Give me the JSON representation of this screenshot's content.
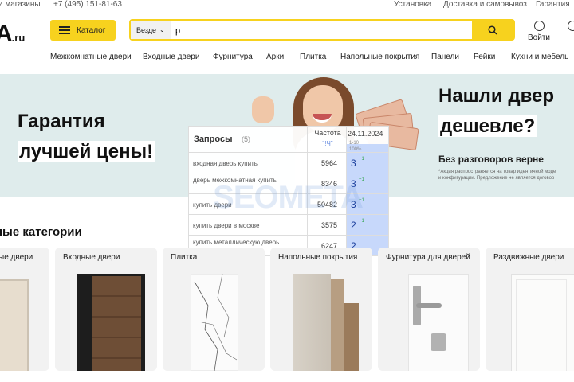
{
  "topbar": {
    "stores": "и магазины",
    "phone": "+7 (495) 151-81-63",
    "install": "Установка",
    "delivery": "Доставка и самовывоз",
    "warranty": "Гарантия"
  },
  "header": {
    "logo": "А",
    "logo_suffix": ".ru",
    "catalog": "Каталог",
    "search_scope": "Везде",
    "search_value": "р",
    "login": "Войти"
  },
  "nav": [
    "Межкомнатные двери",
    "Входные двери",
    "Фурнитура",
    "Арки",
    "Плитка",
    "Напольные покрытия",
    "Панели",
    "Рейки",
    "Кухни и мебель"
  ],
  "banner": {
    "left_line1": "Гарантия",
    "left_line2": "лучшей цены!",
    "right_line1": "Нашли двер",
    "right_line2": "дешевле?",
    "right_sub": "Без разговоров верне",
    "footnote_1": "*Акция распространяется на товар идентичной моде",
    "footnote_2": "и конфигурации. Предложение не является договор"
  },
  "overlay": {
    "title": "Запросы",
    "count": "(5)",
    "freq_label": "Частота",
    "freq_sub": "\"!Ч\"",
    "date": "24.11.2024",
    "range": "1-10",
    "percent": "100%",
    "rows": [
      {
        "query": "входная дверь купить",
        "freq": "5964",
        "pos": "3",
        "delta": "+1"
      },
      {
        "query": "дверь межкомнатная купить",
        "freq": "8346",
        "pos": "3",
        "delta": "+1"
      },
      {
        "query": "купить двери",
        "freq": "50482",
        "pos": "3",
        "delta": "+1"
      },
      {
        "query": "купить двери в москве",
        "freq": "3575",
        "pos": "2",
        "delta": "+1"
      },
      {
        "query": "купить металлическую дверь",
        "freq": "6247",
        "pos": "2",
        "delta": ""
      }
    ],
    "watermark": "SEOMETA"
  },
  "categories": {
    "title": "ные категории",
    "items": [
      "ые двери",
      "Входные двери",
      "Плитка",
      "Напольные покрытия",
      "Фурнитура для дверей",
      "Раздвижные двери"
    ]
  },
  "colors": {
    "accent": "#f7d21e",
    "banner_bg": "#dfecec",
    "position_col": "#c7d8fb"
  }
}
